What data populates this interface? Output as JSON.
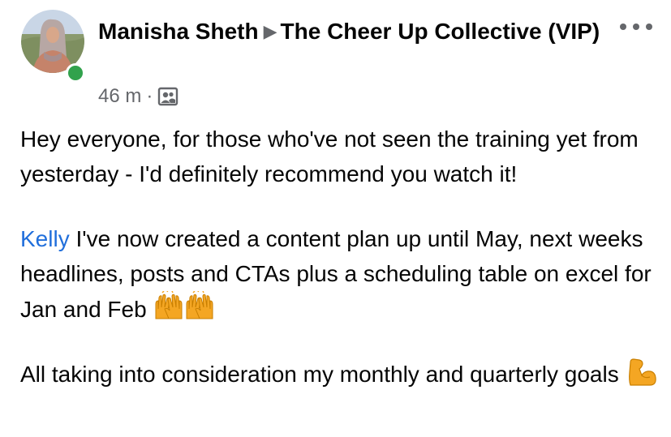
{
  "post": {
    "author": "Manisha Sheth",
    "group": "The Cheer Up Collective (VIP)",
    "timestamp": "46 m",
    "separator": "·",
    "privacy_icon": "group-members-icon",
    "more_icon": "more-options-icon"
  },
  "content": {
    "para1": "Hey everyone, for those who've not seen the training yet from yesterday - I'd definitely recommend you watch it!",
    "mention": "Kelly",
    "para2_rest": " I've now created a content plan up until May, next weeks headlines, posts and CTAs plus a scheduling table on excel for Jan and Feb ",
    "para2_emoji": "raising-hands-emoji",
    "para3": "All taking into consideration my monthly and quarterly goals ",
    "para3_emoji": "flexed-biceps-emoji"
  },
  "colors": {
    "online": "#31a24c",
    "mention": "#216fdb",
    "meta": "#65676b"
  }
}
